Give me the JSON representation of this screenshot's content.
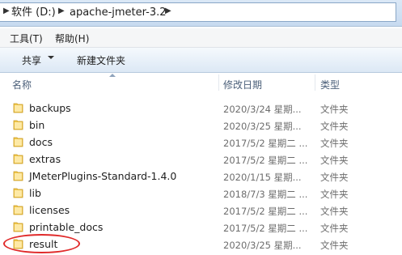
{
  "breadcrumb": {
    "items": [
      "软件 (D:)",
      "apache-jmeter-3.2"
    ]
  },
  "menu": {
    "items": [
      "工具(T)",
      "帮助(H)"
    ]
  },
  "toolbar": {
    "share_label": "共享",
    "new_folder_label": "新建文件夹"
  },
  "columns": {
    "name": "名称",
    "date": "修改日期",
    "type": "类型"
  },
  "files": [
    {
      "name": "backups",
      "date": "2020/3/24 星期...",
      "type": "文件夹"
    },
    {
      "name": "bin",
      "date": "2020/3/25 星期...",
      "type": "文件夹"
    },
    {
      "name": "docs",
      "date": "2017/5/2 星期二 ...",
      "type": "文件夹"
    },
    {
      "name": "extras",
      "date": "2017/5/2 星期二 ...",
      "type": "文件夹"
    },
    {
      "name": "JMeterPlugins-Standard-1.4.0",
      "date": "2020/1/15 星期...",
      "type": "文件夹"
    },
    {
      "name": "lib",
      "date": "2018/7/3 星期二 ...",
      "type": "文件夹"
    },
    {
      "name": "licenses",
      "date": "2017/5/2 星期二 ...",
      "type": "文件夹"
    },
    {
      "name": "printable_docs",
      "date": "2017/5/2 星期二 ...",
      "type": "文件夹"
    },
    {
      "name": "result",
      "date": "2020/3/25 星期...",
      "type": "文件夹"
    }
  ],
  "colors": {
    "highlight_circle": "#e02a2a",
    "folder_yellow": "#f2c84b"
  }
}
